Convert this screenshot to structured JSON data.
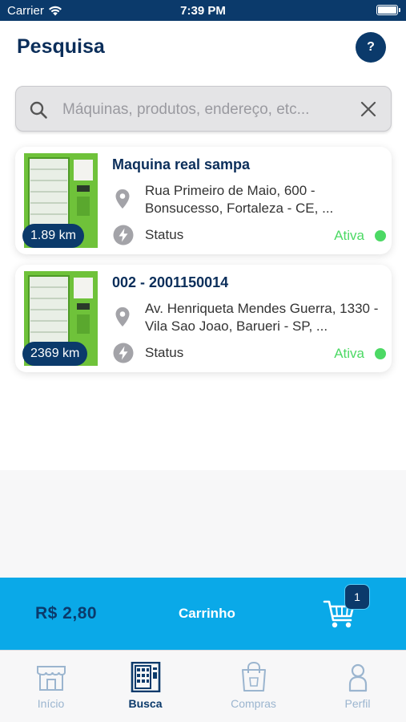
{
  "status_bar": {
    "carrier": "Carrier",
    "time": "7:39 PM"
  },
  "header": {
    "title": "Pesquisa",
    "help_label": "?"
  },
  "search": {
    "placeholder": "Máquinas, produtos, endereço, etc...",
    "value": ""
  },
  "machines": [
    {
      "name": "Maquina real sampa",
      "distance": "1.89 km",
      "address": "Rua Primeiro de Maio, 600 - Bonsucesso, Fortaleza - CE, ...",
      "status_label": "Status",
      "status_value": "Ativa"
    },
    {
      "name": "002 - 2001150014",
      "distance": "2369 km",
      "address": "Av. Henriqueta Mendes Guerra, 1330 - Vila Sao Joao, Barueri - SP, ...",
      "status_label": "Status",
      "status_value": "Ativa"
    }
  ],
  "cart": {
    "total": "R$ 2,80",
    "label": "Carrinho",
    "badge_count": "1"
  },
  "tabs": [
    {
      "label": "Início",
      "icon": "store-icon",
      "active": false
    },
    {
      "label": "Busca",
      "icon": "vending-machine-icon",
      "active": true
    },
    {
      "label": "Compras",
      "icon": "shopping-bag-icon",
      "active": false
    },
    {
      "label": "Perfil",
      "icon": "person-icon",
      "active": false
    }
  ],
  "colors": {
    "navy": "#0b3a6b",
    "accent": "#0aa9e8",
    "active_status": "#4cd964"
  }
}
